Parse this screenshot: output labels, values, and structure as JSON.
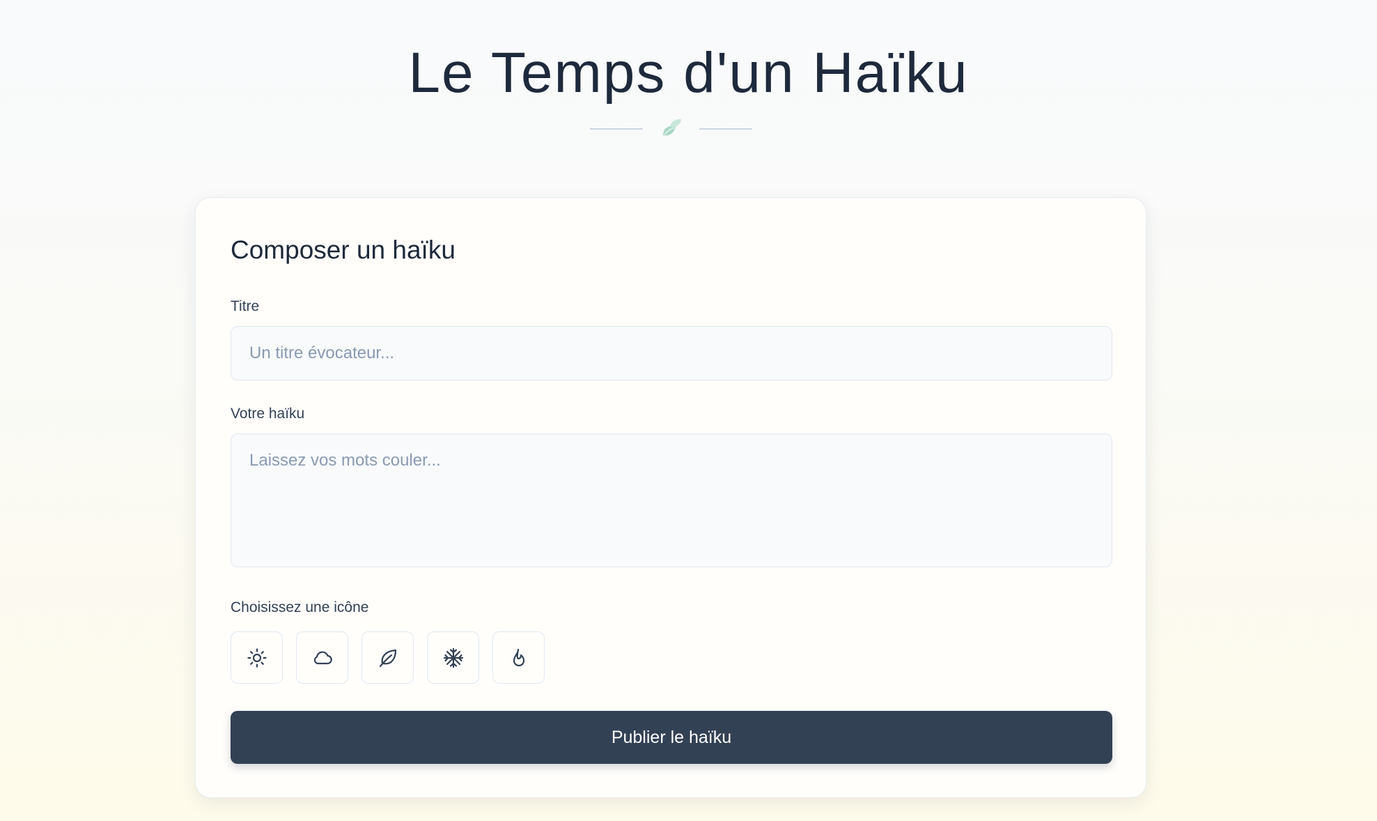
{
  "header": {
    "title": "Le Temps d'un Haïku",
    "divider_icon": "leaf-icon"
  },
  "form": {
    "heading": "Composer un haïku",
    "title_label": "Titre",
    "title_placeholder": "Un titre évocateur...",
    "title_value": "",
    "haiku_label": "Votre haïku",
    "haiku_placeholder": "Laissez vos mots couler...",
    "haiku_value": "",
    "icon_label": "Choisissez une icône",
    "icons": [
      "sun-icon",
      "cloud-icon",
      "leaf-icon",
      "snowflake-icon",
      "flame-icon"
    ],
    "submit_label": "Publier le haïku"
  },
  "colors": {
    "primary": "#334155",
    "text": "#1e293b",
    "accent_leaf": "#a7d7c5",
    "border": "#e2e8f0",
    "input_bg": "#f8fafc"
  }
}
